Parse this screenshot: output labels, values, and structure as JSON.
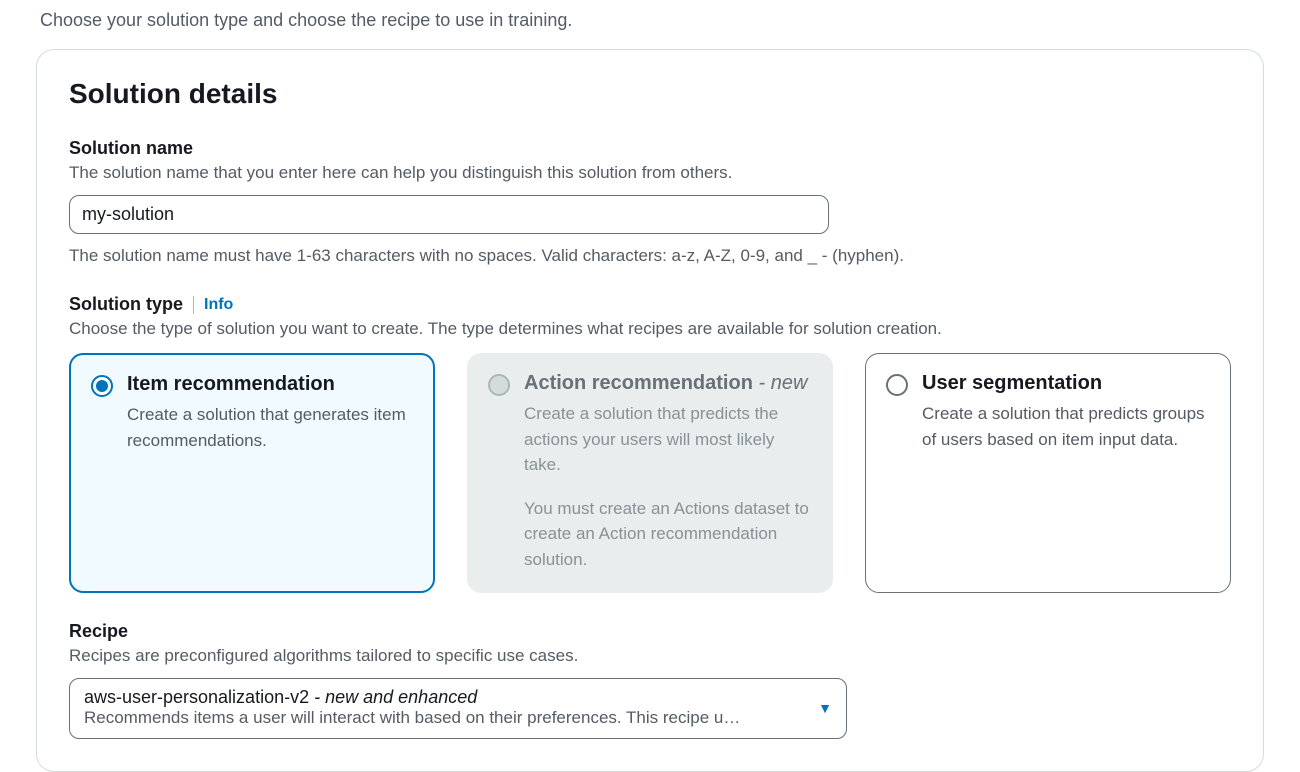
{
  "intro": "Choose your solution type and choose the recipe to use in training.",
  "panel": {
    "header": "Solution details",
    "solution_name": {
      "label": "Solution name",
      "desc": "The solution name that you enter here can help you distinguish this solution from others.",
      "value": "my-solution",
      "constraint": "The solution name must have 1-63 characters with no spaces. Valid characters: a-z, A-Z, 0-9, and _ - (hyphen)."
    },
    "solution_type": {
      "label": "Solution type",
      "info": "Info",
      "desc": "Choose the type of solution you want to create. The type determines what recipes are available for solution creation.",
      "options": [
        {
          "title": "Item recommendation",
          "suffix": "",
          "desc": "Create a solution that generates item recommendations.",
          "note": "",
          "state": "selected"
        },
        {
          "title": "Action recommendation",
          "suffix": " - new",
          "desc": "Create a solution that predicts the actions your users will most likely take.",
          "note": "You must create an Actions dataset to create an Action recommendation solution.",
          "state": "disabled"
        },
        {
          "title": "User segmentation",
          "suffix": "",
          "desc": "Create a solution that predicts groups of users based on item input data.",
          "note": "",
          "state": "default"
        }
      ]
    },
    "recipe": {
      "label": "Recipe",
      "desc": "Recipes are preconfigured algorithms tailored to specific use cases.",
      "selected_value": "aws-user-personalization-v2",
      "selected_suffix": " - new and enhanced",
      "selected_desc": "Recommends items a user will interact with based on their preferences. This recipe u…"
    }
  }
}
